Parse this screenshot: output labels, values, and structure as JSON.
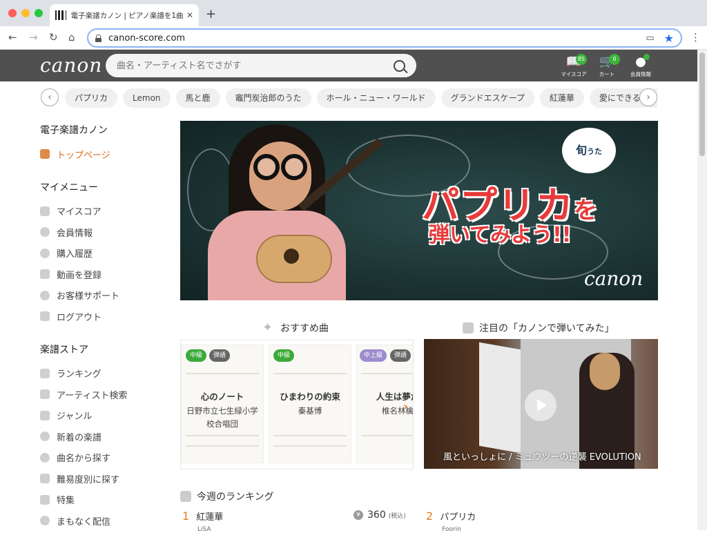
{
  "browser": {
    "tab_title": "電子楽譜カノン | ピアノ楽譜を1曲",
    "url": "canon-score.com"
  },
  "header": {
    "logo": "canon",
    "search_placeholder": "曲名・アーティスト名でさがす",
    "icons": [
      {
        "label": "マイスコア",
        "badge": "85",
        "icon": "book-icon"
      },
      {
        "label": "カート",
        "badge": "0",
        "icon": "cart-icon"
      },
      {
        "label": "会員情報",
        "badge": "",
        "icon": "user-icon"
      }
    ]
  },
  "chips": [
    "パプリカ",
    "Lemon",
    "馬と鹿",
    "竈門炭治郎のうた",
    "ホール・ニュー・ワールド",
    "グランドエスケープ",
    "紅蓮華",
    "愛にできること"
  ],
  "sidebar": {
    "site": {
      "title": "電子楽譜カノン",
      "items": [
        {
          "label": "トップページ",
          "icon": "home-icon",
          "active": true
        }
      ]
    },
    "my_menu": {
      "title": "マイメニュー",
      "items": [
        {
          "label": "マイスコア",
          "icon": "book-icon"
        },
        {
          "label": "会員情報",
          "icon": "user-icon"
        },
        {
          "label": "購入履歴",
          "icon": "clock-icon"
        },
        {
          "label": "動画を登録",
          "icon": "video-icon"
        },
        {
          "label": "お客様サポート",
          "icon": "support-icon"
        },
        {
          "label": "ログアウト",
          "icon": "logout-icon"
        }
      ]
    },
    "store": {
      "title": "楽譜ストア",
      "items": [
        {
          "label": "ランキング",
          "icon": "crown-icon"
        },
        {
          "label": "アーティスト検索",
          "icon": "mic-icon"
        },
        {
          "label": "ジャンル",
          "icon": "piano-icon"
        },
        {
          "label": "新着の楽譜",
          "icon": "new-icon"
        },
        {
          "label": "曲名から探す",
          "icon": "note-icon"
        },
        {
          "label": "難易度別に探す",
          "icon": "level-icon"
        },
        {
          "label": "特集",
          "icon": "feature-icon"
        },
        {
          "label": "まもなく配信",
          "icon": "spark-icon"
        }
      ]
    }
  },
  "banner": {
    "bubble_main": "旬",
    "bubble_sub": "うた",
    "title_main": "パプリカ",
    "title_suffix": "を",
    "subtitle": "弾いてみよう!!",
    "logo": "canon"
  },
  "recommend": {
    "title": "おすすめ曲",
    "cards": [
      {
        "level": "中級",
        "type": "弾語",
        "level_color": "green",
        "title": "心のノート",
        "artist": "日野市立七生緑小学校合唱団"
      },
      {
        "level": "中級",
        "type": "",
        "level_color": "green",
        "title": "ひまわりの約束",
        "artist": "秦基博"
      },
      {
        "level": "中上級",
        "type": "弾語",
        "level_color": "purple",
        "title": "人生は夢だ",
        "artist": "椎名林檎"
      }
    ],
    "next_label": "›"
  },
  "video": {
    "title": "注目の「カノンで弾いてみた」",
    "caption": "風といっしょに / ミュウツーの逆襲 EVOLUTION"
  },
  "ranking": {
    "title": "今週のランキング",
    "items": [
      {
        "rank": "1",
        "title": "紅蓮華",
        "artist": "LiSA",
        "price": "360",
        "tax": "(税込)"
      },
      {
        "rank": "2",
        "title": "パプリカ",
        "artist": "Foorin"
      }
    ]
  }
}
